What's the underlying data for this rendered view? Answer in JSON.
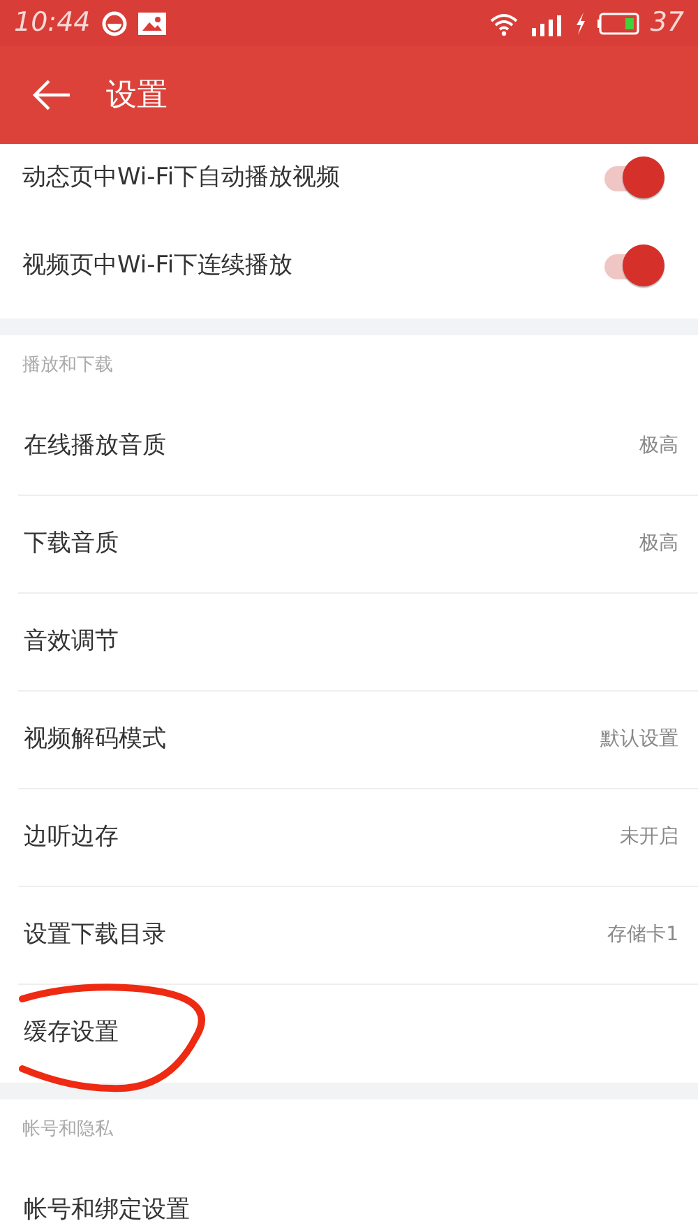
{
  "status_bar": {
    "time": "10:44",
    "battery": "37"
  },
  "app_bar": {
    "title": "设置"
  },
  "toggles": [
    {
      "label": "动态页中Wi-Fi下自动播放视频",
      "on": true
    },
    {
      "label": "视频页中Wi-Fi下连续播放",
      "on": true
    }
  ],
  "sections": [
    {
      "header": "播放和下载",
      "items": [
        {
          "label": "在线播放音质",
          "value": "极高",
          "highlighted": false
        },
        {
          "label": "下载音质",
          "value": "极高",
          "highlighted": false
        },
        {
          "label": "音效调节",
          "highlighted": false
        },
        {
          "label": "视频解码模式",
          "value": "默认设置",
          "highlighted": false
        },
        {
          "label": "边听边存",
          "value": "未开启",
          "highlighted": false
        },
        {
          "label": "设置下载目录",
          "value": "存储卡1",
          "highlighted": false
        },
        {
          "label": "缓存设置",
          "highlighted": true
        }
      ]
    },
    {
      "header": "帐号和隐私",
      "items": [
        {
          "label": "帐号和绑定设置",
          "highlighted": false
        }
      ]
    }
  ]
}
